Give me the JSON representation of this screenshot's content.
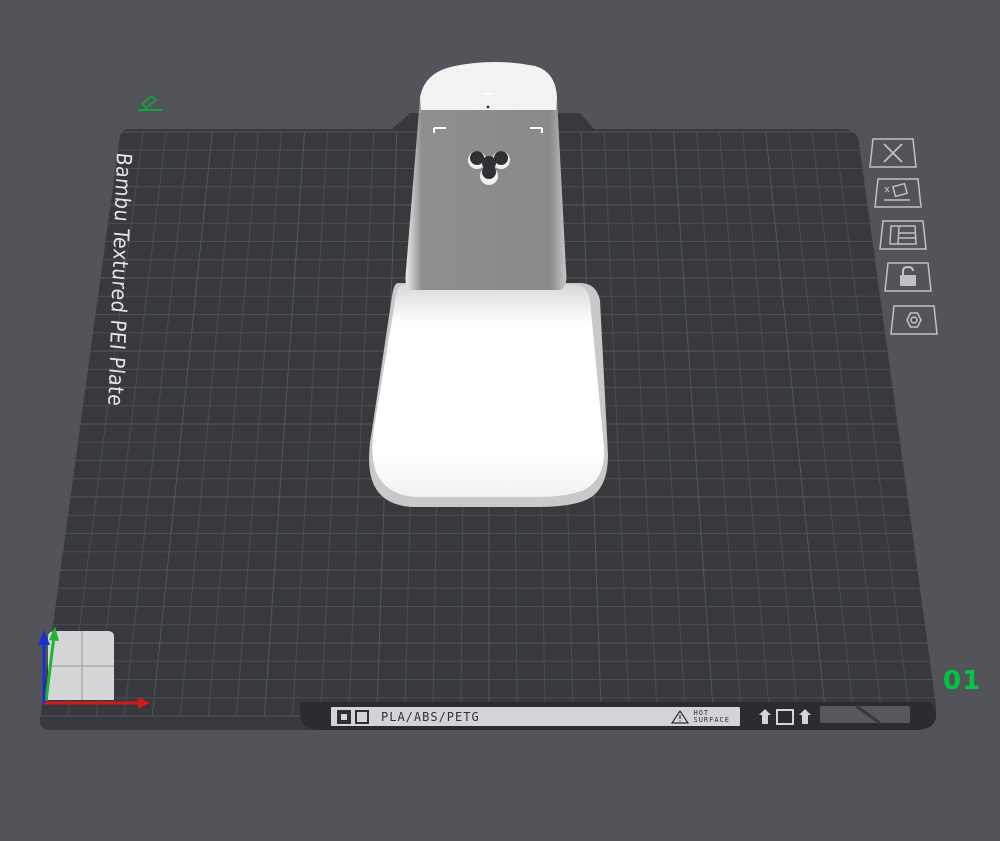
{
  "plate": {
    "label": "Bambu Textured PEI Plate",
    "number": "01",
    "material": "PLA/ABS/PETG",
    "hot_warning_line1": "HOT",
    "hot_warning_line2": "SURFACE"
  },
  "tools": [
    {
      "name": "close",
      "icon": "close-icon"
    },
    {
      "name": "auto-arrange",
      "icon": "arrange-icon"
    },
    {
      "name": "plate-layout",
      "icon": "layout-icon"
    },
    {
      "name": "lock",
      "icon": "lock-icon"
    },
    {
      "name": "plate-settings",
      "icon": "hexagon-settings-icon"
    }
  ],
  "colors": {
    "background": "#525459",
    "plate": "#37393d",
    "grid": "#4b4e53",
    "plate_number": "#00c843",
    "axis_x": "#d11a1a",
    "axis_y": "#1fb62d",
    "axis_z": "#1a2fd1",
    "model": "#e8e8e8"
  }
}
